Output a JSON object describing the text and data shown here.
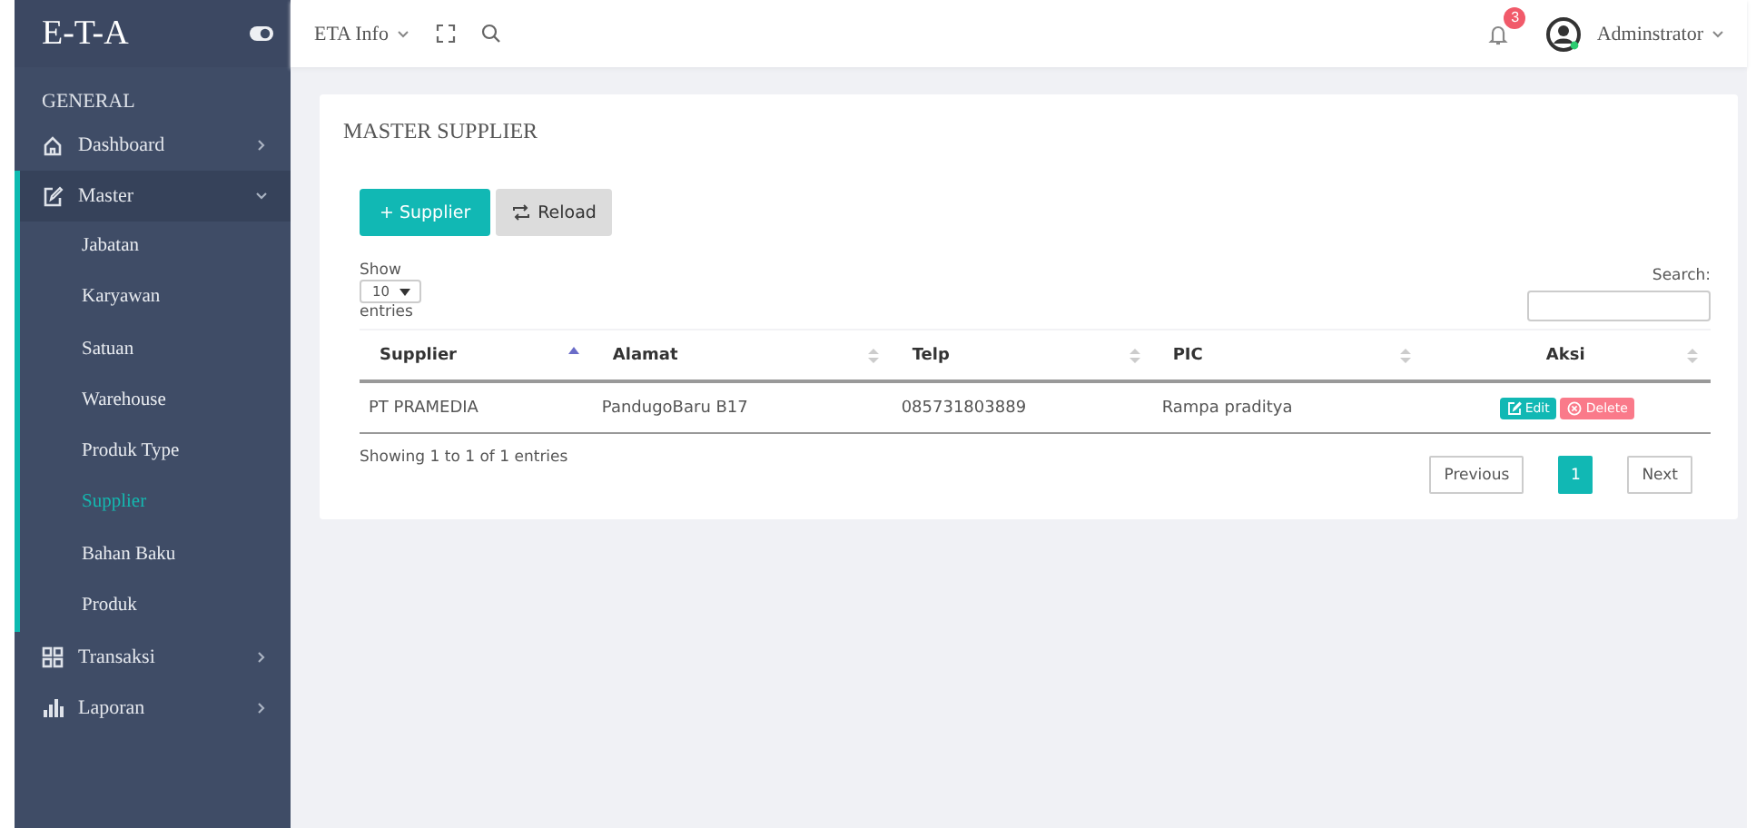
{
  "sidebar": {
    "brand": "E-T-A",
    "section": "GENERAL",
    "items": [
      {
        "label": "Dashboard",
        "kind": "home",
        "expanded": false
      },
      {
        "label": "Master",
        "kind": "edit",
        "expanded": true,
        "children": [
          {
            "label": "Jabatan",
            "selected": false
          },
          {
            "label": "Karyawan",
            "selected": false
          },
          {
            "label": "Satuan",
            "selected": false
          },
          {
            "label": "Warehouse",
            "selected": false
          },
          {
            "label": "Produk Type",
            "selected": false
          },
          {
            "label": "Supplier",
            "selected": true
          },
          {
            "label": "Bahan Baku",
            "selected": false
          },
          {
            "label": "Produk",
            "selected": false
          }
        ]
      },
      {
        "label": "Transaksi",
        "kind": "grid",
        "expanded": false
      },
      {
        "label": "Laporan",
        "kind": "chart",
        "expanded": false
      }
    ]
  },
  "topbar": {
    "menu": "ETA Info",
    "notifications": "3",
    "user": "Adminstrator"
  },
  "page": {
    "title": "MASTER SUPPLIER",
    "buttons": [
      {
        "label": "+ Supplier",
        "kind": "primary"
      },
      {
        "label": "Reload",
        "kind": "reload"
      }
    ],
    "length": {
      "before": "Show",
      "value": "10",
      "after": "entries"
    },
    "search": {
      "label": "Search:"
    },
    "table": {
      "columns": [
        {
          "label": "Supplier",
          "sorted": true
        },
        {
          "label": "Alamat",
          "sorted": false
        },
        {
          "label": "Telp",
          "sorted": false
        },
        {
          "label": "PIC",
          "sorted": false
        },
        {
          "label": "Aksi",
          "sorted": false
        }
      ],
      "rows": [
        {
          "cells": [
            "PT PRAMEDIA",
            "PandugoBaru B17",
            "085731803889",
            "Rampa praditya"
          ],
          "actions": [
            {
              "label": "Edit",
              "kind": "edit"
            },
            {
              "label": "Delete",
              "kind": "delete"
            }
          ]
        }
      ]
    },
    "info": "Showing 1 to 1 of 1 entries",
    "pagination": [
      {
        "label": "Previous",
        "kind": "nav",
        "selected": false
      },
      {
        "label": "1",
        "kind": "page",
        "selected": true
      },
      {
        "label": "Next",
        "kind": "nav",
        "selected": false
      }
    ]
  }
}
